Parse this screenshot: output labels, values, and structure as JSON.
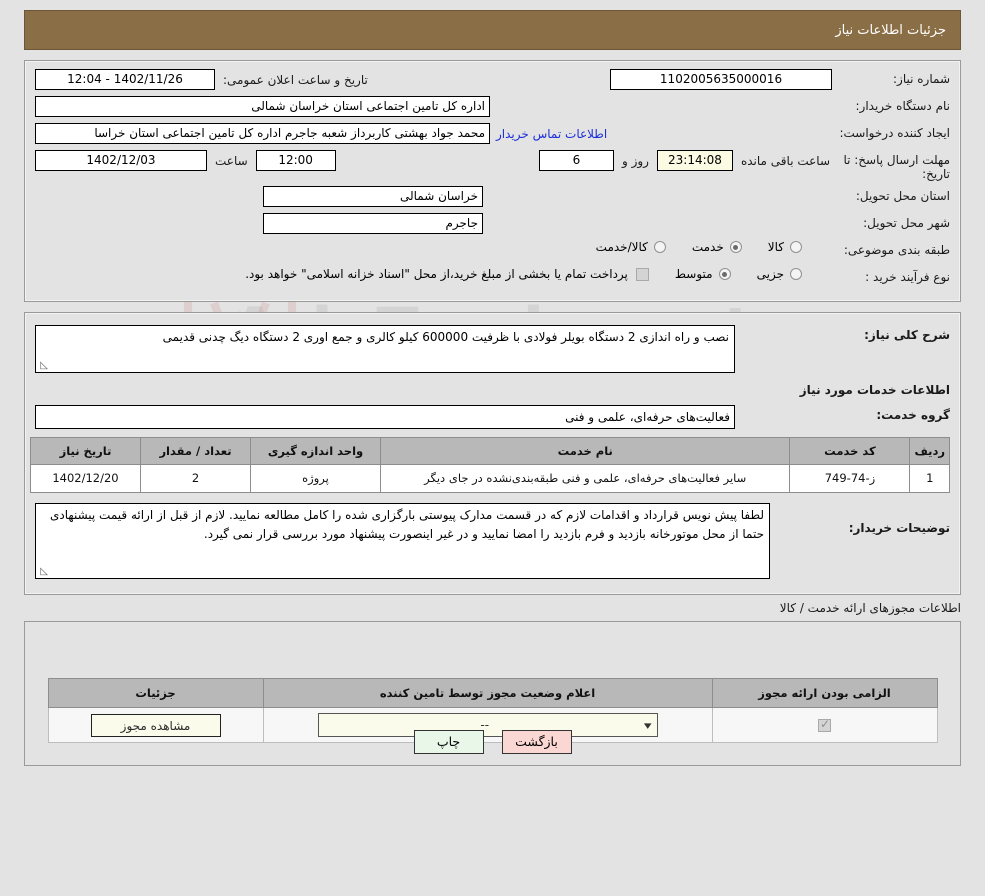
{
  "header": {
    "title": "جزئیات اطلاعات نیاز"
  },
  "watermark": {
    "text": "AriaTender.net"
  },
  "form": {
    "need_number_label": "شماره نیاز:",
    "need_number_value": "1102005635000016",
    "announce_label": "تاریخ و ساعت اعلان عمومی:",
    "announce_value": "1402/11/26 - 12:04",
    "buyer_org_label": "نام دستگاه خریدار:",
    "buyer_org_value": "اداره کل تامین اجتماعی استان خراسان شمالی",
    "creator_label": "ایجاد کننده درخواست:",
    "creator_value": "محمد جواد بهشتی کاربرداز شعبه جاجرم اداره کل تامین اجتماعی استان خراسا",
    "contact_link": "اطلاعات تماس خریدار",
    "deadline_label": "مهلت ارسال پاسخ: تا تاریخ:",
    "deadline_date": "1402/12/03",
    "hour_label": "ساعت",
    "deadline_time": "12:00",
    "days_value": "6",
    "days_label": "روز و",
    "clock_value": "23:14:08",
    "remaining_label": "ساعت باقی مانده",
    "province_label": "استان محل تحویل:",
    "province_value": "خراسان شمالی",
    "city_label": "شهر محل تحویل:",
    "city_value": "جاجرم",
    "category_label": "طبقه بندی موضوعی:",
    "category_options": [
      {
        "label": "کالا",
        "selected": false
      },
      {
        "label": "خدمت",
        "selected": true
      },
      {
        "label": "کالا/خدمت",
        "selected": false
      }
    ],
    "process_label": "نوع فرآیند خرید :",
    "process_options": [
      {
        "label": "جزیی",
        "selected": false
      },
      {
        "label": "متوسط",
        "selected": true
      },
      {
        "label": "پرداخت تمام یا بخشی از مبلغ خرید،از محل \"اسناد خزانه اسلامی\" خواهد بود.",
        "selected": false
      }
    ]
  },
  "description": {
    "label": "شرح کلی نیاز:",
    "value": "نصب و راه اندازی 2 دستگاه بویلر فولادی با ظرفیت 600000 کیلو کالری و جمع اوری 2 دستگاه دیگ چدنی قدیمی"
  },
  "services_section": {
    "heading": "اطلاعات خدمات مورد نیاز",
    "group_label": "گروه خدمت:",
    "group_value": "فعالیت‌های حرفه‌ای، علمی و فنی",
    "table": {
      "columns": [
        "ردیف",
        "کد خدمت",
        "نام خدمت",
        "واحد اندازه گیری",
        "تعداد / مقدار",
        "تاریخ نیاز"
      ],
      "rows": [
        {
          "row": "1",
          "code": "ز-74-749",
          "name": "سایر فعالیت‌های حرفه‌ای، علمی و فنی طبقه‌بندی‌نشده در جای دیگر",
          "unit": "پروژه",
          "quantity": "2",
          "need_date": "1402/12/20"
        }
      ]
    }
  },
  "buyer_notes": {
    "label": "توضیحات خریدار:",
    "value": "لطفا پیش نویس قرارداد و اقدامات لازم که در قسمت مدارک پیوستی بارگزاری شده را  کامل مطالعه نمایید. لازم از قبل از ارائه قیمت پیشنهادی حتما از محل موتورخانه بازدید و فرم بازدید را امضا نمایید و در غیر اینصورت پیشنهاد مورد بررسی قرار نمی گیرد."
  },
  "permits_section": {
    "heading": "اطلاعات مجوزهای ارائه خدمت / کالا",
    "columns": [
      "الزامی بودن ارائه مجوز",
      "اعلام وضعیت مجوز توسط تامین کننده",
      "جزئیات"
    ],
    "rows": [
      {
        "required_checked": true,
        "status_value": "--",
        "details_button": "مشاهده مجوز"
      }
    ]
  },
  "footer": {
    "print_label": "چاپ",
    "back_label": "بازگشت"
  }
}
